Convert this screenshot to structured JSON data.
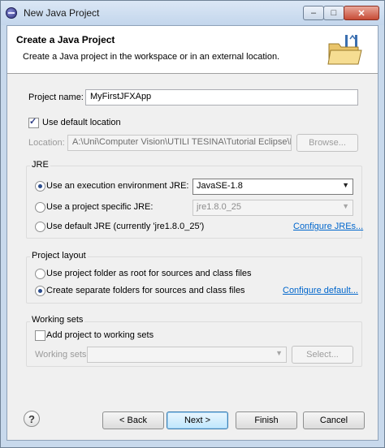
{
  "window": {
    "title": "New Java Project",
    "controls": {
      "minimize": "–",
      "maximize": "□",
      "close": "✕"
    }
  },
  "banner": {
    "title": "Create a Java Project",
    "description": "Create a Java project in the workspace or in an external location."
  },
  "project": {
    "name_label": "Project name:",
    "name_value": "MyFirstJFXApp",
    "use_default_location_label": "Use default location",
    "use_default_location_checked": true,
    "location_label": "Location:",
    "location_value": "A:\\Uni\\Computer Vision\\UTILI TESINA\\Tutorial Eclipse\\MyF",
    "browse_label": "Browse..."
  },
  "jre": {
    "group_title": "JRE",
    "execution_env_label": "Use an execution environment JRE:",
    "execution_env_value": "JavaSE-1.8",
    "project_specific_label": "Use a project specific JRE:",
    "project_specific_value": "jre1.8.0_25",
    "default_label": "Use default JRE (currently 'jre1.8.0_25')",
    "configure_link": "Configure JREs...",
    "selected": "execution_env"
  },
  "layout": {
    "group_title": "Project layout",
    "option_root": "Use project folder as root for sources and class files",
    "option_separate": "Create separate folders for sources and class files",
    "configure_link": "Configure default...",
    "selected": "separate"
  },
  "working_sets": {
    "group_title": "Working sets",
    "add_label": "Add project to working sets",
    "add_checked": false,
    "sets_label": "Working sets:",
    "sets_value": "",
    "select_label": "Select..."
  },
  "footer": {
    "help_label": "?",
    "back_label": "< Back",
    "next_label": "Next >",
    "finish_label": "Finish",
    "cancel_label": "Cancel"
  }
}
